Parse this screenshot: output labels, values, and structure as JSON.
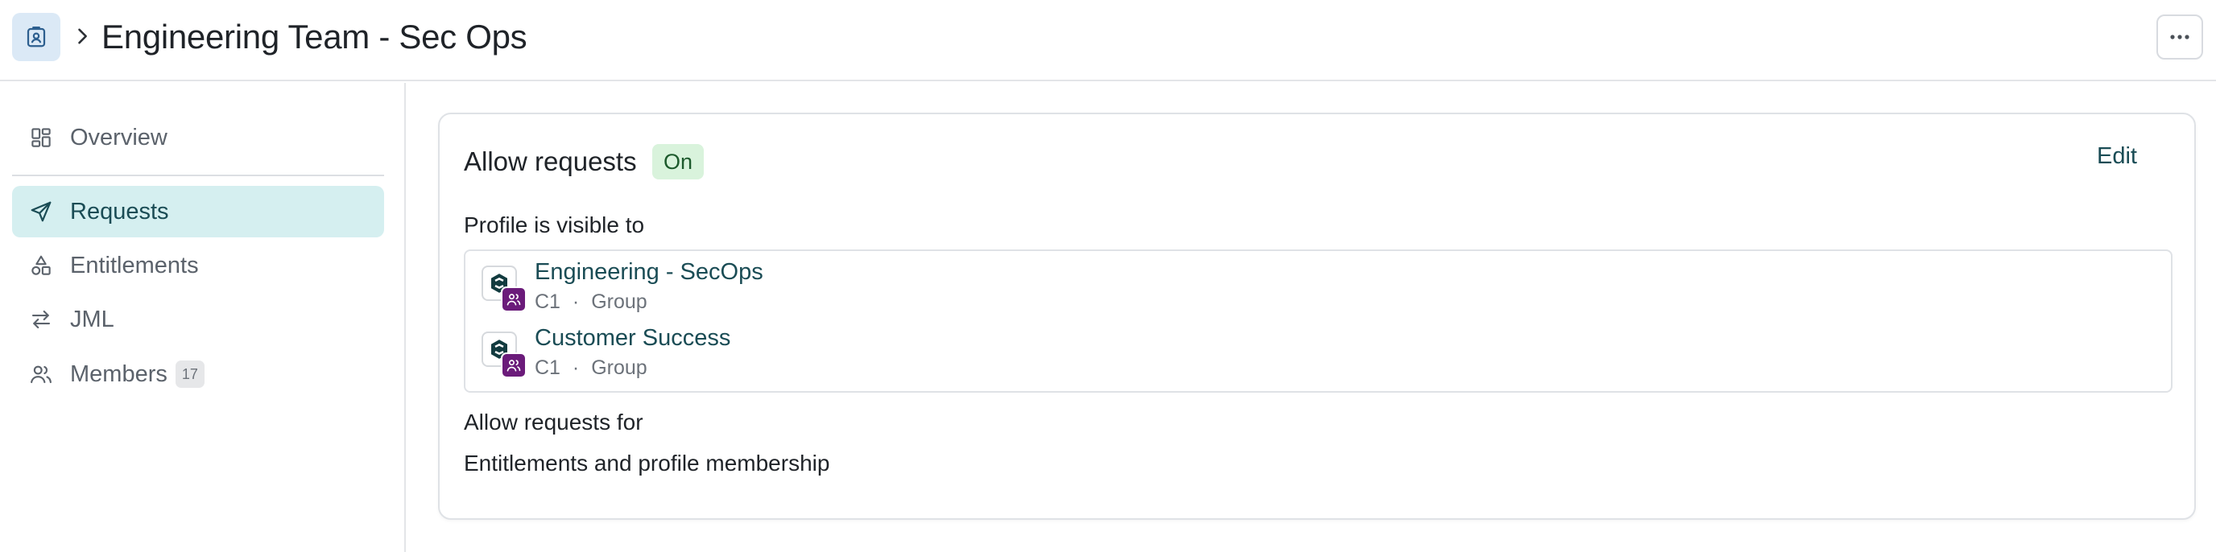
{
  "header": {
    "title": "Engineering Team - Sec Ops",
    "icon": "profile-badge-icon",
    "more_icon": "ellipsis-icon"
  },
  "sidebar": {
    "items": [
      {
        "label": "Overview",
        "icon": "grid-icon",
        "active": false
      },
      {
        "label": "Requests",
        "icon": "paper-plane-icon",
        "active": true
      },
      {
        "label": "Entitlements",
        "icon": "shapes-icon",
        "active": false
      },
      {
        "label": "JML",
        "icon": "arrows-exchange-icon",
        "active": false
      },
      {
        "label": "Members",
        "icon": "users-icon",
        "active": false,
        "count": "17"
      }
    ]
  },
  "main": {
    "card": {
      "title": "Allow requests",
      "status": "On",
      "edit_label": "Edit",
      "visible_label": "Profile is visible to",
      "groups": [
        {
          "name": "Engineering - SecOps",
          "source": "C1",
          "separator": "·",
          "type": "Group"
        },
        {
          "name": "Customer Success",
          "source": "C1",
          "separator": "·",
          "type": "Group"
        }
      ],
      "allow_for_label": "Allow requests for",
      "allow_for_value": "Entitlements and profile membership"
    }
  },
  "colors": {
    "accent": "#1a4c55",
    "active_bg": "#d5eff0",
    "status_bg": "#d9f3dc",
    "group_chip": "#6b1b7a"
  }
}
